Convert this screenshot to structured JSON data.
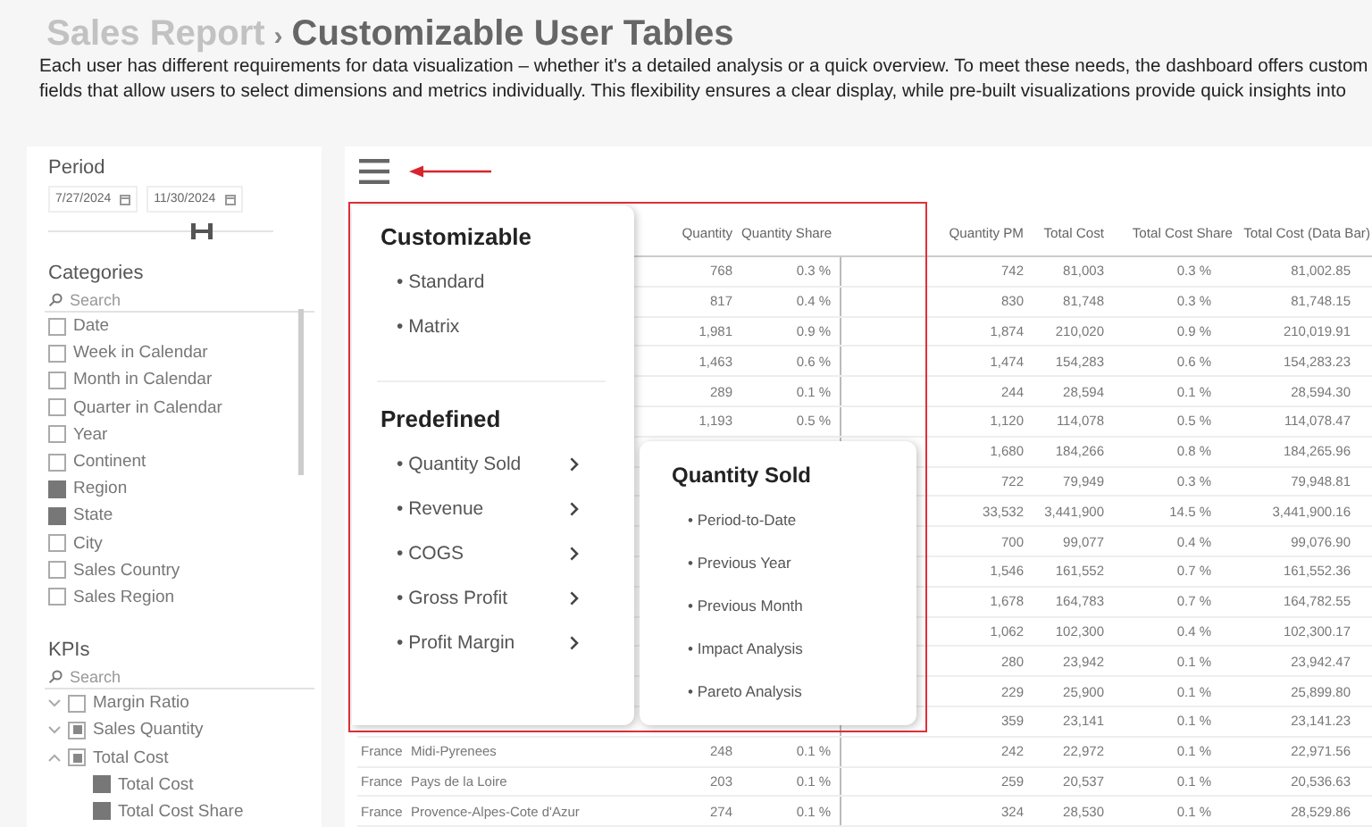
{
  "header": {
    "breadcrumb": "Sales Report",
    "separator": "›",
    "title": "Customizable User Tables",
    "description": [
      "Each user has different requirements for data visualization – whether it's a detailed analysis or a quick overview. To meet these needs, the dashboard offers custom",
      "fields that allow users to select dimensions and metrics individually. This flexibility ensures a clear display, while pre-built visualizations provide quick insights into"
    ]
  },
  "sidebar": {
    "period": {
      "label": "Period",
      "start": "7/27/2024",
      "end": "11/30/2024",
      "level": 0.68
    },
    "categories": {
      "label": "Categories",
      "search_placeholder": "Search",
      "items": [
        {
          "label": "Date",
          "checked": false
        },
        {
          "label": "Week in Calendar",
          "checked": false
        },
        {
          "label": "Month in Calendar",
          "checked": false
        },
        {
          "label": "Quarter in Calendar",
          "checked": false
        },
        {
          "label": "Year",
          "checked": false
        },
        {
          "label": "Continent",
          "checked": false
        },
        {
          "label": "Region",
          "checked": true
        },
        {
          "label": "State",
          "checked": true
        },
        {
          "label": "City",
          "checked": false
        },
        {
          "label": "Sales Country",
          "checked": false
        },
        {
          "label": "Sales Region",
          "checked": false
        }
      ]
    },
    "kpis": {
      "label": "KPIs",
      "search_placeholder": "Search",
      "items": [
        {
          "label": "Margin Ratio",
          "partial": false,
          "expanded": false
        },
        {
          "label": "Sales Quantity",
          "partial": true,
          "expanded": false
        },
        {
          "label": "Total Cost",
          "partial": true,
          "expanded": true,
          "children": [
            {
              "label": "Total Cost",
              "checked": true
            },
            {
              "label": "Total Cost Share",
              "checked": true
            }
          ]
        }
      ]
    }
  },
  "table": {
    "columns": [
      "",
      "",
      "Quantity",
      "Quantity Share",
      "",
      "Quantity PM",
      "Total Cost",
      "Total Cost Share",
      "Total Cost (Data Bar)"
    ],
    "rows": [
      [
        "",
        "",
        "768",
        "0.3 %",
        "",
        "742",
        "81,003",
        "0.3 %",
        "81,002.85"
      ],
      [
        "",
        "",
        "817",
        "0.4 %",
        "",
        "830",
        "81,748",
        "0.3 %",
        "81,748.15"
      ],
      [
        "",
        "",
        "1,981",
        "0.9 %",
        "",
        "1,874",
        "210,020",
        "0.9 %",
        "210,019.91"
      ],
      [
        "",
        "",
        "1,463",
        "0.6 %",
        "",
        "1,474",
        "154,283",
        "0.6 %",
        "154,283.23"
      ],
      [
        "",
        "",
        "289",
        "0.1 %",
        "",
        "244",
        "28,594",
        "0.1 %",
        "28,594.30"
      ],
      [
        "",
        "",
        "1,193",
        "0.5 %",
        "",
        "1,120",
        "114,078",
        "0.5 %",
        "114,078.47"
      ],
      [
        "",
        "",
        "",
        "",
        "",
        "1,680",
        "184,266",
        "0.8 %",
        "184,265.96"
      ],
      [
        "",
        "",
        "",
        "",
        "",
        "722",
        "79,949",
        "0.3 %",
        "79,948.81"
      ],
      [
        "",
        "",
        "",
        "",
        "",
        "33,532",
        "3,441,900",
        "14.5 %",
        "3,441,900.16"
      ],
      [
        "",
        "",
        "",
        "",
        "",
        "700",
        "99,077",
        "0.4 %",
        "99,076.90"
      ],
      [
        "",
        "",
        "",
        "",
        "",
        "1,546",
        "161,552",
        "0.7 %",
        "161,552.36"
      ],
      [
        "",
        "",
        "",
        "",
        "",
        "1,678",
        "164,783",
        "0.7 %",
        "164,782.55"
      ],
      [
        "",
        "",
        "",
        "",
        "",
        "1,062",
        "102,300",
        "0.4 %",
        "102,300.17"
      ],
      [
        "",
        "",
        "",
        "",
        "",
        "280",
        "23,942",
        "0.1 %",
        "23,942.47"
      ],
      [
        "",
        "",
        "",
        "",
        "",
        "229",
        "25,900",
        "0.1 %",
        "25,899.80"
      ],
      [
        "",
        "",
        "",
        "",
        "",
        "359",
        "23,141",
        "0.1 %",
        "23,141.23"
      ],
      [
        "France",
        "Midi-Pyrenees",
        "248",
        "0.1 %",
        "",
        "242",
        "22,972",
        "0.1 %",
        "22,971.56"
      ],
      [
        "France",
        "Pays de la Loire",
        "203",
        "0.1 %",
        "",
        "259",
        "20,537",
        "0.1 %",
        "20,536.63"
      ],
      [
        "France",
        "Provence-Alpes-Cote d'Azur",
        "274",
        "0.1 %",
        "",
        "324",
        "28,530",
        "0.1 %",
        "28,529.86"
      ]
    ]
  },
  "menu": {
    "sections": [
      {
        "title": "Customizable",
        "items": [
          {
            "label": "• Standard",
            "submenu": false
          },
          {
            "label": "• Matrix",
            "submenu": false
          }
        ]
      },
      {
        "title": "Predefined",
        "items": [
          {
            "label": "• Quantity Sold",
            "submenu": true
          },
          {
            "label": "• Revenue",
            "submenu": true
          },
          {
            "label": "• COGS",
            "submenu": true
          },
          {
            "label": "• Gross Profit",
            "submenu": true
          },
          {
            "label": "• Profit Margin",
            "submenu": true
          }
        ]
      }
    ],
    "submenu": {
      "title": "Quantity Sold",
      "items": [
        "• Period-to-Date",
        "• Previous Year",
        "• Previous Month",
        "• Impact Analysis",
        "• Pareto Analysis"
      ]
    }
  }
}
